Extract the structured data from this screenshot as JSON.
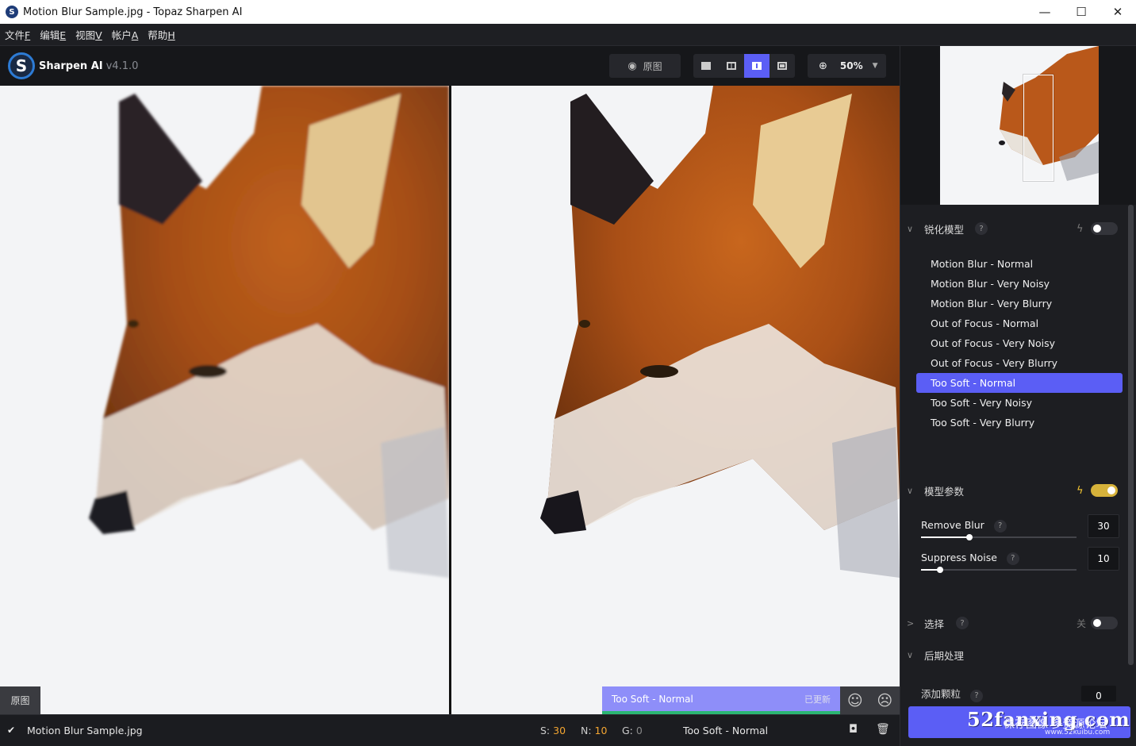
{
  "window": {
    "title": "Motion Blur Sample.jpg - Topaz Sharpen AI",
    "minimize": "—",
    "maximize": "☐",
    "close": "✕"
  },
  "menu": [
    {
      "label": "文件",
      "key": "F"
    },
    {
      "label": "编辑",
      "key": "E"
    },
    {
      "label": "视图",
      "key": "V"
    },
    {
      "label": "帐户",
      "key": "A"
    },
    {
      "label": "帮助",
      "key": "H"
    }
  ],
  "toolbar": {
    "product_name": "Sharpen AI",
    "version": "v4.1.0",
    "original_label": "原图",
    "zoom": "50%",
    "active_view": 2
  },
  "preview": {
    "original_label": "原图",
    "model_name": "Too Soft - Normal",
    "updated_label": "已更新"
  },
  "status": {
    "file_name": "Motion Blur Sample.jpg",
    "s_label": "S:",
    "s_value": "30",
    "n_label": "N:",
    "n_value": "10",
    "g_label": "G:",
    "g_value": "0",
    "model": "Too Soft - Normal"
  },
  "sidebar": {
    "model_section": {
      "title": "锐化模型",
      "help": "?",
      "auto_enabled": false,
      "models": [
        "Motion Blur - Normal",
        "Motion Blur - Very Noisy",
        "Motion Blur - Very Blurry",
        "Out of Focus - Normal",
        "Out of Focus - Very Noisy",
        "Out of Focus - Very Blurry",
        "Too Soft - Normal",
        "Too Soft - Very Noisy",
        "Too Soft - Very Blurry"
      ],
      "selected_index": 6
    },
    "params_section": {
      "title": "模型参数",
      "auto_enabled": true,
      "remove_blur": {
        "label": "Remove Blur",
        "help": "?",
        "value": "30",
        "fraction": 0.31
      },
      "suppress_noise": {
        "label": "Suppress Noise",
        "help": "?",
        "value": "10",
        "fraction": 0.12
      }
    },
    "select_section": {
      "title": "选择",
      "help": "?",
      "state_label": "关",
      "enabled": false
    },
    "post_section": {
      "title": "后期处理",
      "grain_label": "添加颗粒",
      "grain_help": "?",
      "grain_value": "0"
    },
    "watermark": {
      "line1": "52fanxing.com",
      "line2": "保存图像 多资源论坛",
      "line3": "www.52kuibu.com"
    }
  },
  "colors": {
    "accent": "#5b5ef5",
    "highlight": "#f3a531",
    "toggle_on": "#d6b23a",
    "updated_bar": "#2bb673"
  }
}
